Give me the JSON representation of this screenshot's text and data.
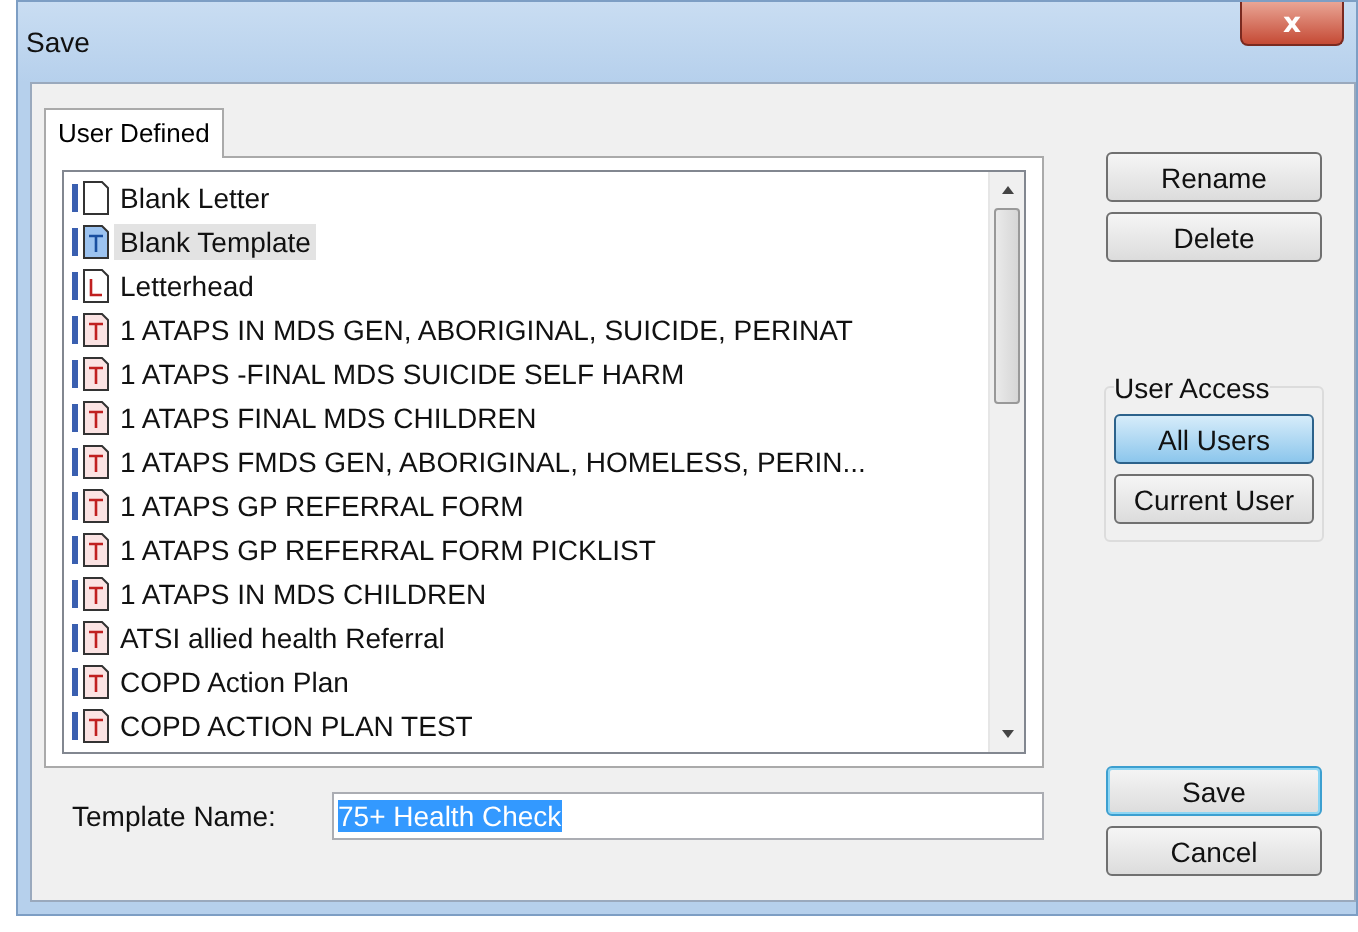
{
  "window": {
    "title": "Save",
    "close": "x"
  },
  "tabs": [
    {
      "label": "User Defined",
      "selected": true
    }
  ],
  "templates": [
    {
      "name": "Blank Letter",
      "kind": "blank",
      "selected": false
    },
    {
      "name": "Blank Template",
      "kind": "template",
      "selected": true
    },
    {
      "name": "Letterhead",
      "kind": "letterhead",
      "selected": false
    },
    {
      "name": "1 ATAPS  IN MDS GEN, ABORIGINAL, SUICIDE, PERINAT",
      "kind": "document",
      "selected": false
    },
    {
      "name": "1 ATAPS -FINAL  MDS SUICIDE SELF HARM",
      "kind": "document",
      "selected": false
    },
    {
      "name": "1 ATAPS FINAL MDS CHILDREN",
      "kind": "document",
      "selected": false
    },
    {
      "name": "1 ATAPS FMDS GEN, ABORIGINAL, HOMELESS, PERIN...",
      "kind": "document",
      "selected": false
    },
    {
      "name": "1 ATAPS GP REFERRAL FORM",
      "kind": "document",
      "selected": false
    },
    {
      "name": "1 ATAPS GP REFERRAL FORM PICKLIST",
      "kind": "document",
      "selected": false
    },
    {
      "name": "1 ATAPS IN MDS CHILDREN",
      "kind": "document",
      "selected": false
    },
    {
      "name": "ATSI allied health Referral",
      "kind": "document",
      "selected": false
    },
    {
      "name": "COPD Action Plan",
      "kind": "document",
      "selected": false
    },
    {
      "name": "COPD ACTION PLAN TEST",
      "kind": "document",
      "selected": false
    }
  ],
  "edit_buttons": [
    "Rename",
    "Delete"
  ],
  "user_access": {
    "title": "User Access",
    "options": [
      {
        "label": "All Users",
        "selected": true
      },
      {
        "label": "Current User",
        "selected": false
      }
    ]
  },
  "template_name": {
    "label": "Template Name:",
    "value": "75+ Health Check",
    "text_selected": true
  },
  "dialog_buttons": [
    {
      "label": "Save",
      "default": true
    },
    {
      "label": "Cancel",
      "default": false
    }
  ]
}
